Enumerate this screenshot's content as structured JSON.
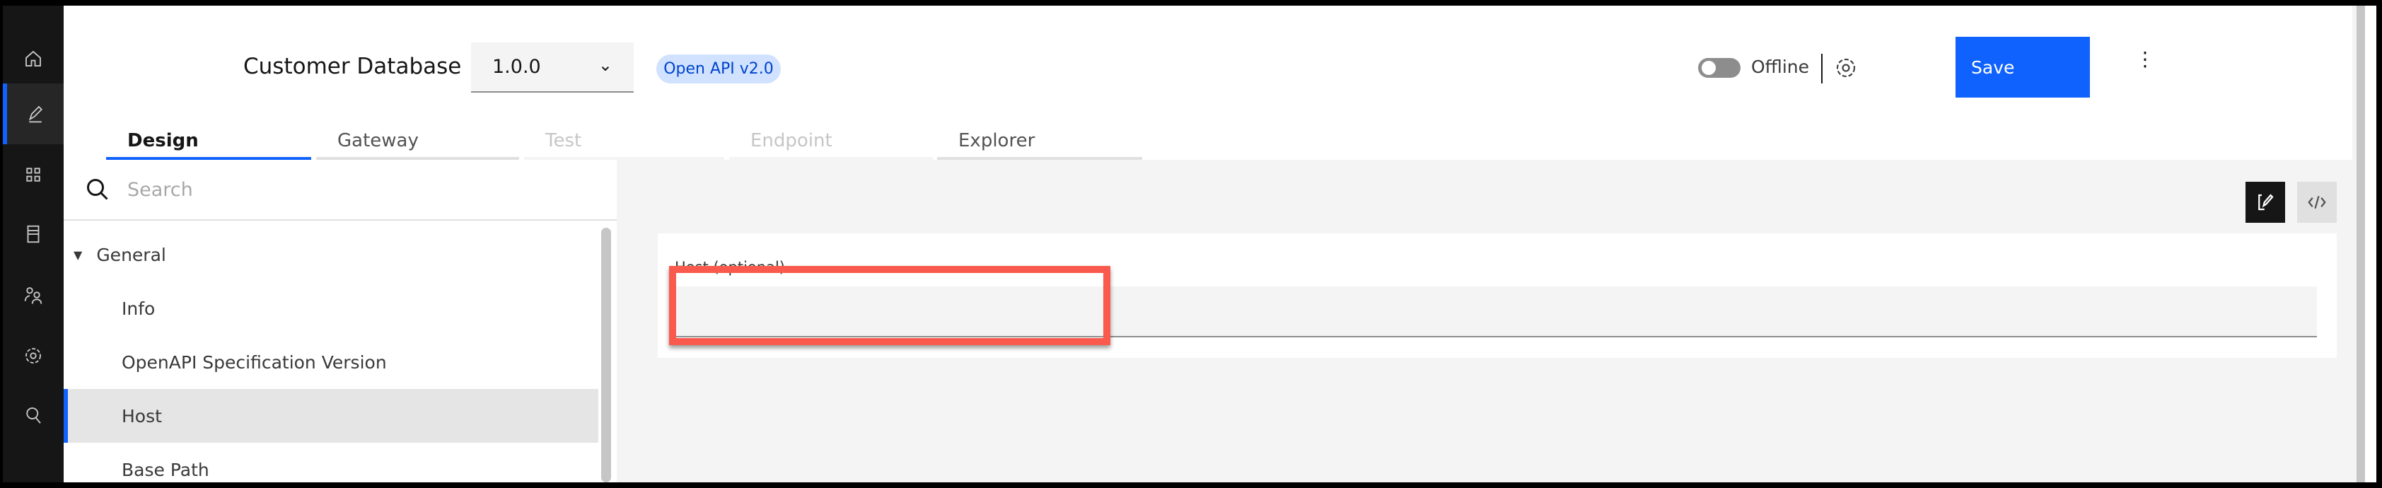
{
  "nav": {
    "items": [
      {
        "icon": "home-icon"
      },
      {
        "icon": "edit-icon",
        "active": true
      },
      {
        "icon": "apps-icon"
      },
      {
        "icon": "catalog-icon"
      },
      {
        "icon": "users-icon"
      },
      {
        "icon": "settings-icon"
      },
      {
        "icon": "search-icon"
      }
    ]
  },
  "header": {
    "title": "Customer Database",
    "version": "1.0.0",
    "badge": "Open API v2.0",
    "toggle_label": "Offline",
    "toggle_on": false,
    "save_label": "Save"
  },
  "tabs": [
    {
      "label": "Design",
      "state": "selected"
    },
    {
      "label": "Gateway",
      "state": "normal"
    },
    {
      "label": "Test",
      "state": "disabled"
    },
    {
      "label": "Endpoint",
      "state": "disabled"
    },
    {
      "label": "Explorer",
      "state": "normal"
    }
  ],
  "sidebar": {
    "search_placeholder": "Search",
    "section": "General",
    "items": [
      "Info",
      "OpenAPI Specification Version",
      "Host",
      "Base Path"
    ],
    "selected": "Host"
  },
  "form": {
    "host_label": "Host (optional)",
    "host_value": ""
  },
  "colors": {
    "accent": "#0f62fe",
    "highlight": "#fa5a4e",
    "nav_bg": "#161616",
    "badge_bg": "#d0e2ff"
  }
}
